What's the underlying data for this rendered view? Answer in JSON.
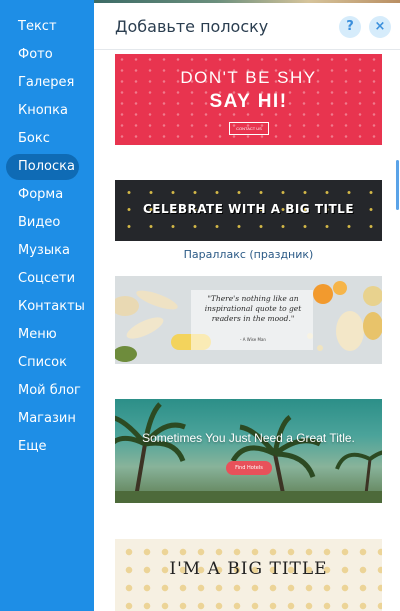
{
  "sidebar": {
    "items": [
      {
        "label": "Текст"
      },
      {
        "label": "Фото"
      },
      {
        "label": "Галерея"
      },
      {
        "label": "Кнопка"
      },
      {
        "label": "Бокс"
      },
      {
        "label": "Полоска",
        "active": true
      },
      {
        "label": "Форма"
      },
      {
        "label": "Видео"
      },
      {
        "label": "Музыка"
      },
      {
        "label": "Соцсети"
      },
      {
        "label": "Контакты"
      },
      {
        "label": "Меню"
      },
      {
        "label": "Список"
      },
      {
        "label": "Мой блог"
      },
      {
        "label": "Магазин"
      },
      {
        "label": "Еще"
      }
    ]
  },
  "panel": {
    "title": "Добавьте полоску",
    "help_label": "?",
    "close_label": "×"
  },
  "strips": [
    {
      "line1": "DON'T BE SHY",
      "line2": "SAY HI!",
      "button": "CONTACT US"
    },
    {
      "title": "CELEBRATE WITH A BIG TITLE",
      "caption": "Параллакс (праздник)"
    },
    {
      "quote": "\"There's nothing like an inspirational quote to get readers in the mood.\"",
      "author": "- A Wise Man"
    },
    {
      "title": "Sometimes You Just Need a Great Title.",
      "button": "Find Hotels"
    },
    {
      "title": "I'M A BIG TITLE"
    }
  ],
  "colors": {
    "sidebar_bg": "#1e8ee6",
    "sidebar_active": "#0f6bb5",
    "accent": "#3a8fdc"
  }
}
